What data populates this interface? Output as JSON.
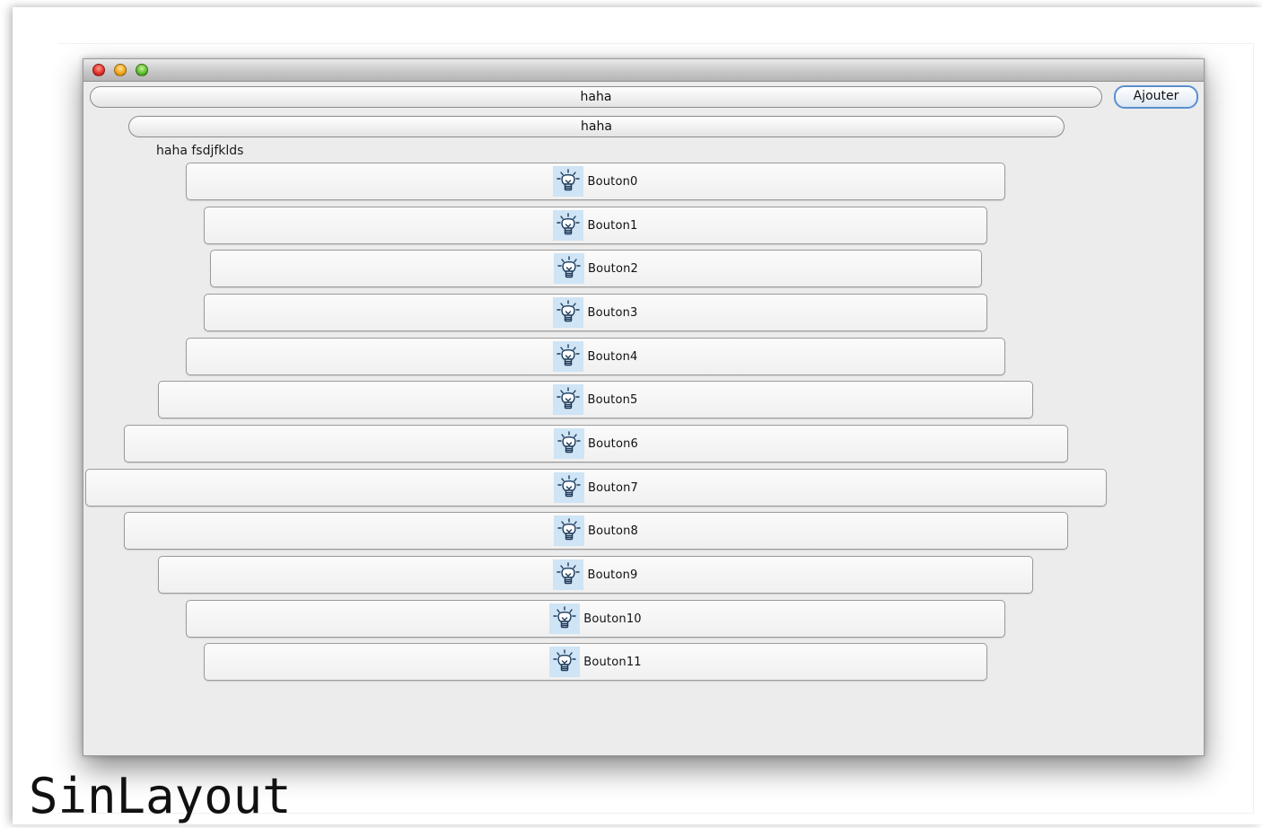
{
  "window": {
    "field1": "haha",
    "ajouter_label": "Ajouter",
    "field2": "haha",
    "label": "haha fsdjfklds",
    "buttons": [
      {
        "label": "Bouton0",
        "icon": "lightbulb-icon"
      },
      {
        "label": "Bouton1",
        "icon": "lightbulb-icon"
      },
      {
        "label": "Bouton2",
        "icon": "lightbulb-icon"
      },
      {
        "label": "Bouton3",
        "icon": "lightbulb-icon"
      },
      {
        "label": "Bouton4",
        "icon": "lightbulb-icon"
      },
      {
        "label": "Bouton5",
        "icon": "lightbulb-icon"
      },
      {
        "label": "Bouton6",
        "icon": "lightbulb-icon"
      },
      {
        "label": "Bouton7",
        "icon": "lightbulb-icon"
      },
      {
        "label": "Bouton8",
        "icon": "lightbulb-icon"
      },
      {
        "label": "Bouton9",
        "icon": "lightbulb-icon"
      },
      {
        "label": "Bouton10",
        "icon": "lightbulb-icon"
      },
      {
        "label": "Bouton11",
        "icon": "lightbulb-icon"
      }
    ]
  },
  "caption": "SinLayout"
}
